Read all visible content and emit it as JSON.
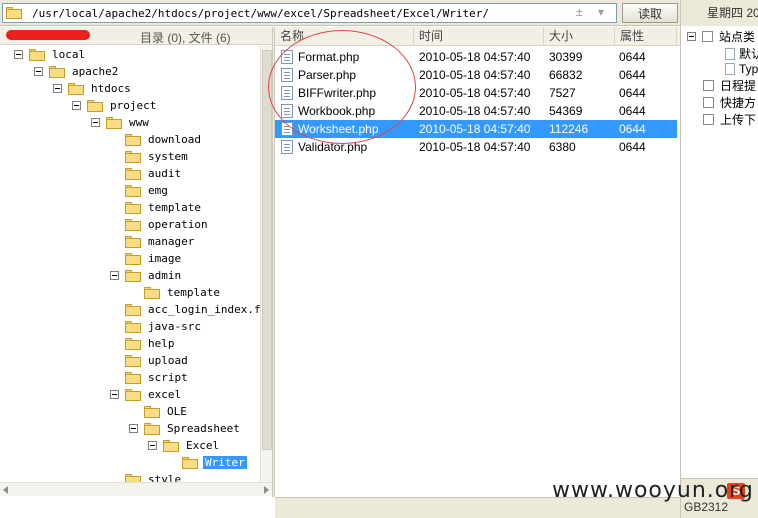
{
  "topbar": {
    "path": "/usr/local/apache2/htdocs/project/www/excel/Spreadsheet/Excel/Writer/",
    "path_ops": "± ▾",
    "read_button": "读取"
  },
  "tree": {
    "summary": "目录 (0), 文件 (6)",
    "nodes": [
      {
        "label": "local",
        "expanded": true
      },
      {
        "label": "apache2",
        "expanded": true
      },
      {
        "label": "htdocs",
        "expanded": true
      },
      {
        "label": "project",
        "expanded": true
      },
      {
        "label": "www",
        "expanded": true
      },
      {
        "label": "download"
      },
      {
        "label": "system"
      },
      {
        "label": "audit"
      },
      {
        "label": "emg"
      },
      {
        "label": "template"
      },
      {
        "label": "operation"
      },
      {
        "label": "manager"
      },
      {
        "label": "image"
      },
      {
        "label": "admin",
        "expanded": true
      },
      {
        "label": "template"
      },
      {
        "label": "acc_login_index.fil"
      },
      {
        "label": "java-src"
      },
      {
        "label": "help"
      },
      {
        "label": "upload"
      },
      {
        "label": "script"
      },
      {
        "label": "excel",
        "expanded": true
      },
      {
        "label": "OLE"
      },
      {
        "label": "Spreadsheet",
        "expanded": true
      },
      {
        "label": "Excel",
        "expanded": true
      },
      {
        "label": "Writer",
        "selected": true
      },
      {
        "label": "style"
      }
    ]
  },
  "filelist": {
    "columns": {
      "name": "名称",
      "time": "时间",
      "size": "大小",
      "attr": "属性"
    },
    "rows": [
      {
        "name": "Format.php",
        "time": "2010-05-18 04:57:40",
        "size": "30399",
        "attr": "0644"
      },
      {
        "name": "Parser.php",
        "time": "2010-05-18 04:57:40",
        "size": "66832",
        "attr": "0644"
      },
      {
        "name": "BIFFwriter.php",
        "time": "2010-05-18 04:57:40",
        "size": "7527",
        "attr": "0644"
      },
      {
        "name": "Workbook.php",
        "time": "2010-05-18 04:57:40",
        "size": "54369",
        "attr": "0644"
      },
      {
        "name": "Worksheet.php",
        "time": "2010-05-18 04:57:40",
        "size": "112246",
        "attr": "0644",
        "selected": true
      },
      {
        "name": "Validator.php",
        "time": "2010-05-18 04:57:40",
        "size": "6380",
        "attr": "0644"
      }
    ]
  },
  "right": {
    "weekday": "星期四 20",
    "items": {
      "site_category": "站点类",
      "default": "默认",
      "type": "Typ",
      "schedule": "日程提",
      "shortcut": "快捷方",
      "upload": "上传下"
    },
    "encoding": "GB2312",
    "badge": "S"
  },
  "watermark": "www.wooyun.org",
  "colors": {
    "selection": "#3399ff",
    "redaction": "#ee1f1f",
    "annotation_circle": "#e04545"
  }
}
